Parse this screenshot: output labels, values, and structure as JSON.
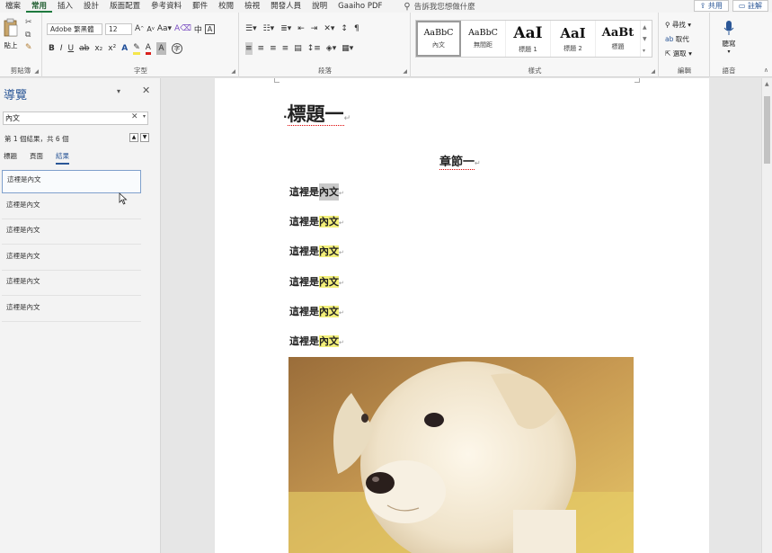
{
  "menu": {
    "items": [
      "檔案",
      "常用",
      "插入",
      "設計",
      "版面配置",
      "參考資料",
      "郵件",
      "校閱",
      "檢視",
      "開發人員",
      "說明",
      "Gaaiho PDF"
    ],
    "active_index": 1,
    "search_text": "告訴我您想做什麼",
    "share_label": "共用",
    "comments_label": "註解"
  },
  "ribbon": {
    "clipboard": {
      "paste_label": "貼上",
      "group_label": "剪貼簿"
    },
    "font": {
      "font_name": "Adobe 繁黑體",
      "font_size": "12",
      "group_label": "字型",
      "text_effect_color": "#1f4e99",
      "highlight_color": "#f5e64a",
      "font_color": "#d9201c"
    },
    "paragraph": {
      "group_label": "段落"
    },
    "styles": {
      "group_label": "樣式",
      "tiles": [
        {
          "preview": "AaBbC",
          "name": "內文"
        },
        {
          "preview": "AaBbC",
          "name": "無間距"
        },
        {
          "preview": "AaI",
          "name": "標題 1"
        },
        {
          "preview": "AaI",
          "name": "標題 2"
        },
        {
          "preview": "AaBt",
          "name": "標題"
        }
      ],
      "selected_index": 0
    },
    "editing": {
      "find_label": "尋找",
      "replace_label": "取代",
      "select_label": "選取",
      "group_label": "編輯"
    },
    "voice": {
      "dictate_label": "聽寫",
      "group_label": "語音"
    }
  },
  "nav": {
    "title": "導覽",
    "search_value": "內文",
    "result_text": "第 1 個結果，共 6 個",
    "tabs": [
      "標題",
      "頁面",
      "結果"
    ],
    "active_tab": 2,
    "results": [
      "這裡是內文",
      "這裡是內文",
      "這裡是內文",
      "這裡是內文",
      "這裡是內文",
      "這裡是內文"
    ],
    "selected_result": 0
  },
  "document": {
    "heading": "標題一",
    "subheading": "章節一",
    "paragraph_prefix": "這裡是",
    "paragraph_match": "內文",
    "paragraph_count": 6,
    "match_highlight_color": "#f3f07a",
    "current_match_color": "#c9c9c9",
    "image_alt": "puppy photo"
  }
}
